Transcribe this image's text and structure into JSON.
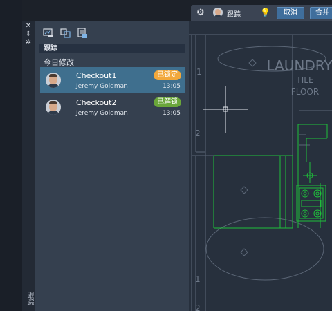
{
  "toolbar": {
    "tracking_label": "跟踪",
    "cancel_label": "取消",
    "merge_label": "合并"
  },
  "panel": {
    "vertical_title": "跟踪",
    "header": "跟踪",
    "group_label": "今日修改",
    "items": [
      {
        "title": "Checkout1",
        "user": "Jeremy Goldman",
        "time": "13:05",
        "status": "已锁定",
        "selected": true
      },
      {
        "title": "Checkout2",
        "user": "Jeremy Goldman",
        "time": "13:05",
        "status": "已解锁",
        "selected": false
      }
    ]
  },
  "drawing": {
    "labels": [
      "LAUNDRY",
      "TILE",
      "FLOOR"
    ],
    "room_numbers": [
      "1",
      "2",
      "1",
      "2"
    ]
  },
  "icons": {
    "close": "✕",
    "pin": "⇔",
    "gear": "⚙",
    "bulb": "💡"
  },
  "colors": {
    "accent": "#3f6e9c",
    "locked": "#f2a83b",
    "unlocked": "#6aa63a",
    "selected_row": "#3f6f8e",
    "drawing_lines": "#1fbf3a"
  }
}
